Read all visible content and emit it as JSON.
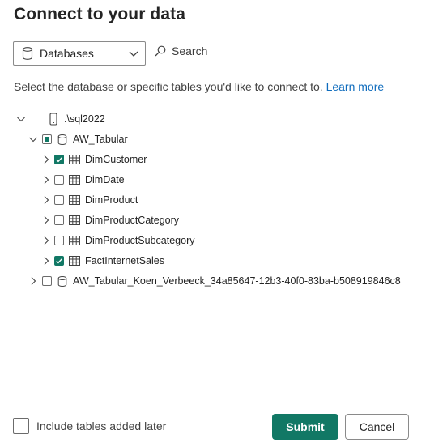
{
  "title": "Connect to your data",
  "source_dropdown": {
    "selected": "Databases",
    "icon": "database-icon"
  },
  "search": {
    "label": "Search",
    "icon": "search-icon"
  },
  "description": {
    "text": "Select the database or specific tables you'd like to connect to.",
    "link": "Learn more"
  },
  "tree": {
    "server": {
      "label": ".\\sql2022",
      "icon": "server-icon",
      "expanded": true
    },
    "database": {
      "label": "AW_Tabular",
      "state": "partial",
      "expanded": true
    },
    "tables": [
      {
        "label": "DimCustomer",
        "checked": true
      },
      {
        "label": "DimDate",
        "checked": false
      },
      {
        "label": "DimProduct",
        "checked": false
      },
      {
        "label": "DimProductCategory",
        "checked": false
      },
      {
        "label": "DimProductSubcategory",
        "checked": false
      },
      {
        "label": "FactInternetSales",
        "checked": true
      }
    ],
    "other_database": {
      "label": "AW_Tabular_Koen_Verbeeck_34a85647-12b3-40f0-83ba-b508919846c8",
      "checked": false,
      "expanded": false
    }
  },
  "include_later": {
    "label": "Include tables added later",
    "checked": false
  },
  "buttons": {
    "submit": "Submit",
    "cancel": "Cancel"
  },
  "colors": {
    "accent": "#117865",
    "link": "#0f6cbd"
  }
}
